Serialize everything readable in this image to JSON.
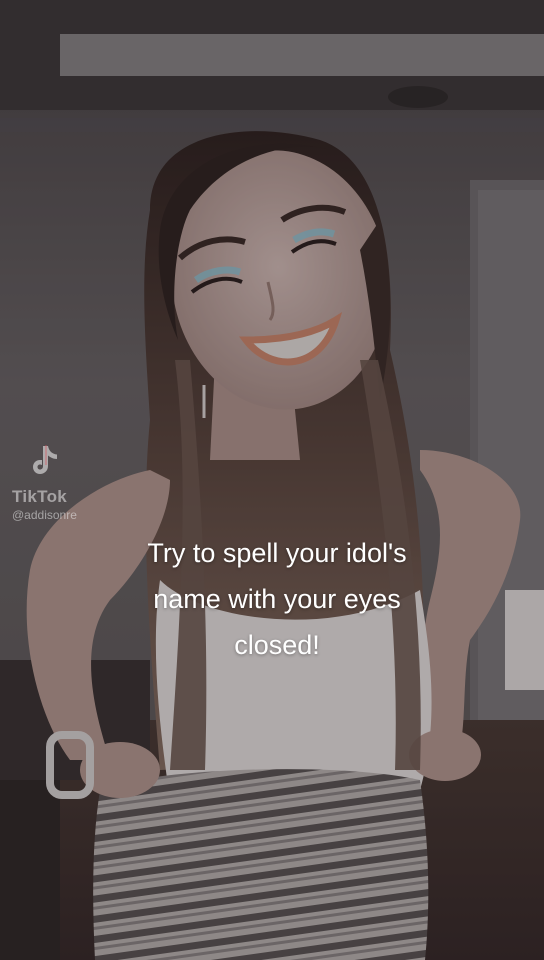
{
  "watermark": {
    "brand": "TikTok",
    "handle": "@addisonre",
    "icon": "tiktok-note-icon"
  },
  "caption": {
    "line1": "Try to spell your idol's",
    "line2": "name with your eyes",
    "line3": "closed!"
  }
}
